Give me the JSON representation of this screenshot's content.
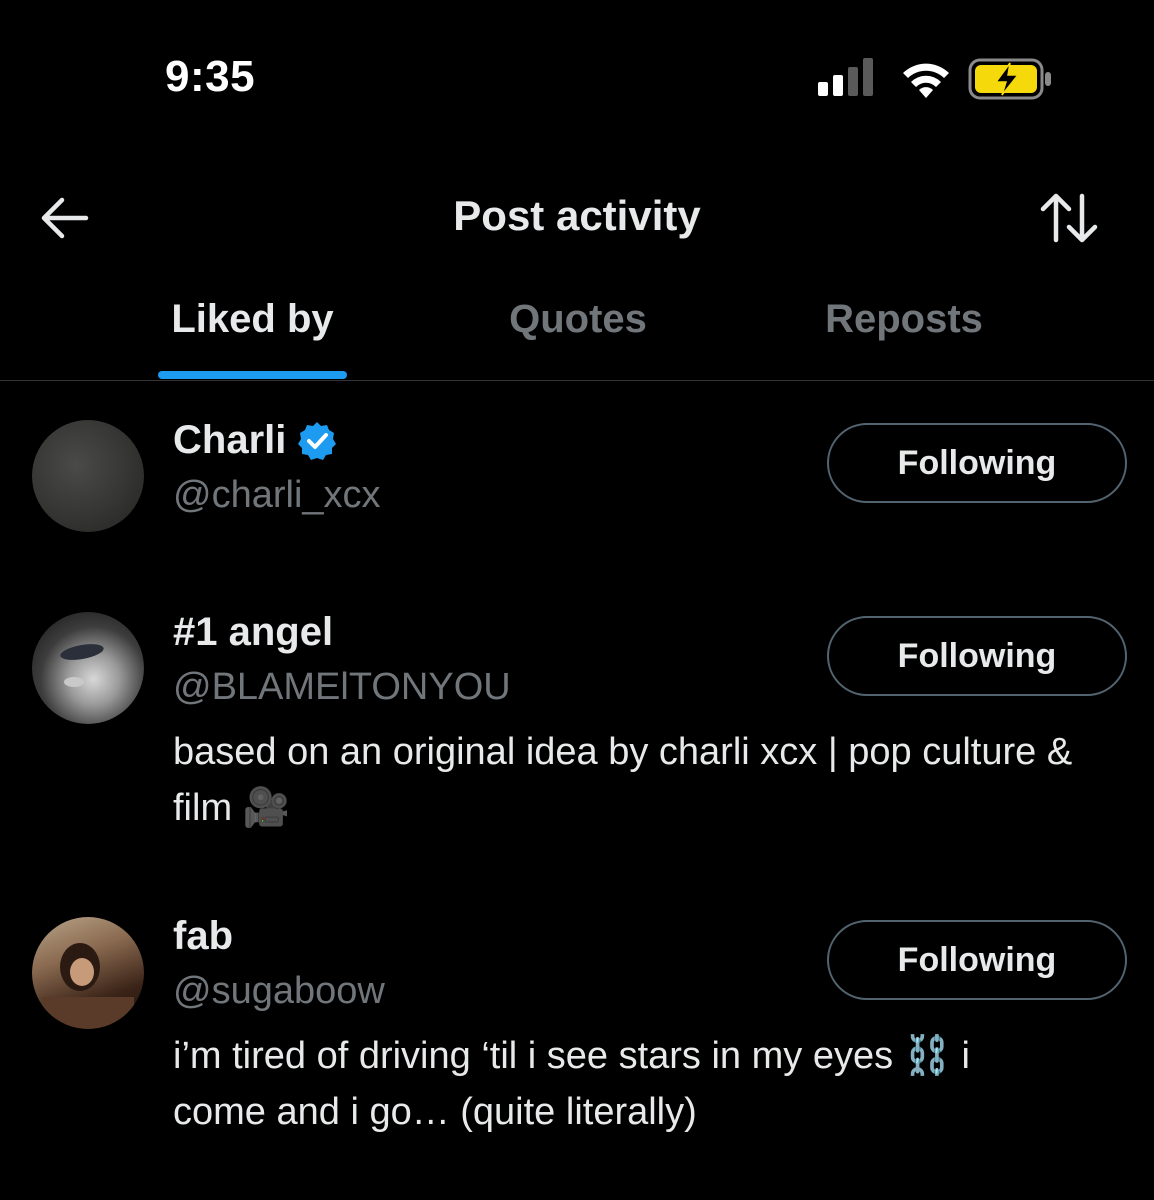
{
  "status_bar": {
    "time": "9:35"
  },
  "header": {
    "title": "Post activity"
  },
  "tabs": [
    {
      "label": "Liked by",
      "active": true
    },
    {
      "label": "Quotes",
      "active": false
    },
    {
      "label": "Reposts",
      "active": false
    }
  ],
  "users": [
    {
      "name": "Charli",
      "verified": true,
      "handle": "@charli_xcx",
      "bio": "",
      "button": "Following"
    },
    {
      "name": "#1 angel",
      "verified": false,
      "handle": "@BLAMElTONYOU",
      "bio": "based on an original idea by charli xcx | pop culture & film 🎥",
      "button": "Following"
    },
    {
      "name": "fab",
      "verified": false,
      "handle": "@sugaboow",
      "bio": "i’m tired of driving ‘til i see stars in my eyes ⛓️ i come and i go… (quite literally)",
      "button": "Following"
    }
  ],
  "colors": {
    "background": "#000000",
    "accent": "#1d9bf0",
    "text_primary": "#e7e9ea",
    "text_secondary": "#71767b",
    "battery_charging": "#f5d90a"
  },
  "icons": [
    "back-arrow-icon",
    "sort-icon",
    "verified-badge-icon",
    "signal-icon",
    "wifi-icon",
    "battery-charging-icon"
  ]
}
